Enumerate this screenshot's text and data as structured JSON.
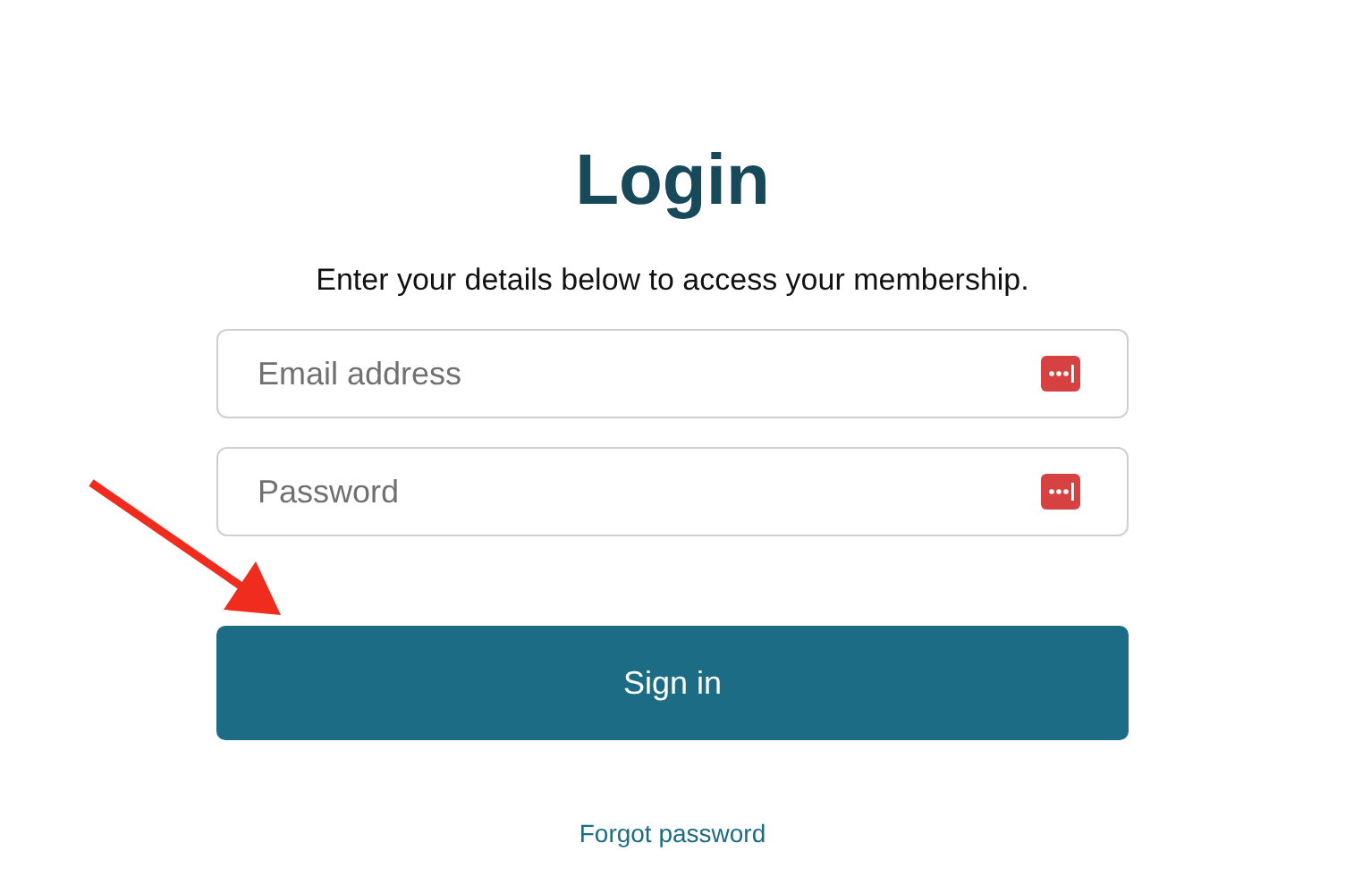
{
  "title": "Login",
  "subtitle": "Enter your details below to access your membership.",
  "fields": [
    {
      "placeholder": "Email address"
    },
    {
      "placeholder": "Password"
    }
  ],
  "submit": "Sign in",
  "forgot_link": "Forgot password"
}
